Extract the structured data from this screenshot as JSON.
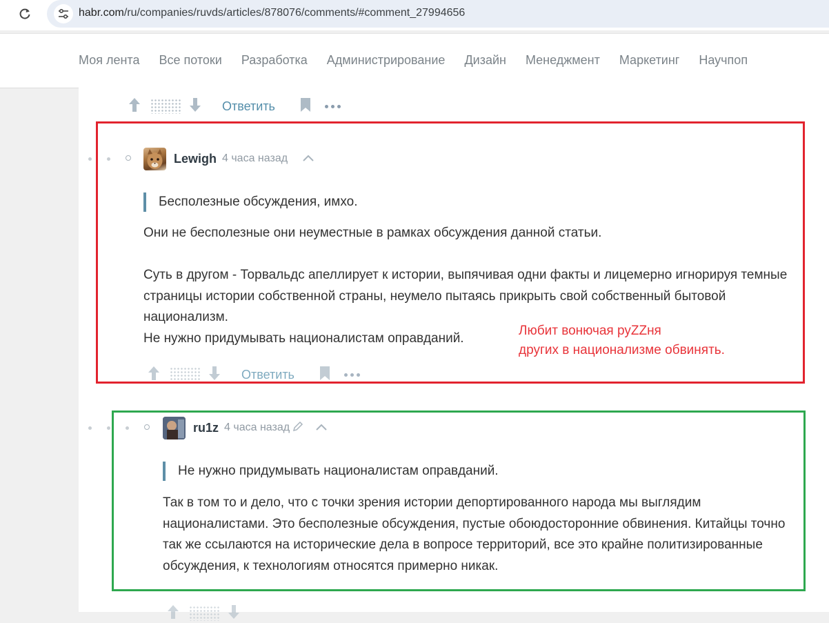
{
  "browser": {
    "url_host": "habr.com",
    "url_path": "/ru/companies/ruvds/articles/878076/comments/#comment_27994656"
  },
  "nav": {
    "items": [
      "Моя лента",
      "Все потоки",
      "Разработка",
      "Администрирование",
      "Дизайн",
      "Менеджмент",
      "Маркетинг",
      "Научпоп"
    ]
  },
  "actions": {
    "reply_label": "Ответить"
  },
  "comments": [
    {
      "username": "Lewigh",
      "time": "4 часа назад",
      "quote": "Бесполезные обсуждения, имхо.",
      "paragraphs": [
        "Они не бесполезные они неуместные в рамках обсуждения данной статьи.",
        "Суть в другом - Торвальдс апеллирует к истории, выпячивая одни факты и лицемерно игнорируя темные страницы истории собственной страны, неумело пытаясь прикрыть свой собственный бытовой национализм.",
        "Не нужно придумывать националистам оправданий."
      ]
    },
    {
      "username": "ru1z",
      "time": "4 часа назад",
      "quote": "Не нужно придумывать националистам оправданий.",
      "paragraphs": [
        "Так в том то и дело, что с точки зрения истории депортированного народа мы выглядим националистами. Это бесполезные обсуждения, пустые обоюдосторонние обвинения. Китайцы точно так же ссылаются на исторические дела в вопросе территорий, все это крайне политизированные обсуждения, к технологиям относятся примерно никак."
      ]
    }
  ],
  "annotation": {
    "line1": "Любит вонючая руZZня",
    "line2": "других в национализме обвинять."
  },
  "colors": {
    "red_box": "#e2232e",
    "green_box": "#2ea84f",
    "annotation": "#e8343a",
    "reply_link": "#548eaa"
  }
}
